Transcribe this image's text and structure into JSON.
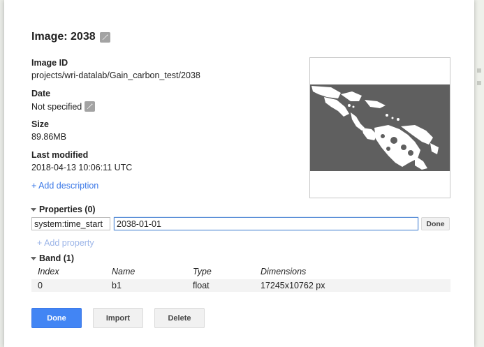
{
  "dialog": {
    "title": "Image: 2038",
    "image_id_label": "Image ID",
    "image_id_value": "projects/wri-datalab/Gain_carbon_test/2038",
    "date_label": "Date",
    "date_value": "Not specified",
    "size_label": "Size",
    "size_value": "89.86MB",
    "modified_label": "Last modified",
    "modified_value": "2018-04-13 10:06:11 UTC",
    "add_description": "+ Add description"
  },
  "properties": {
    "header": "Properties (0)",
    "key": "system:time_start",
    "value": "2038-01-01",
    "done_label": "Done",
    "add_property": "+ Add property"
  },
  "band": {
    "header": "Band (1)",
    "columns": [
      "Index",
      "Name",
      "Type",
      "Dimensions"
    ],
    "rows": [
      [
        "0",
        "b1",
        "float",
        "17245x10762 px"
      ]
    ]
  },
  "buttons": {
    "done": "Done",
    "import": "Import",
    "delete": "Delete"
  },
  "colors": {
    "accent": "#4285f4",
    "link": "#3b78e7",
    "thumbnail_bg": "#5f5f5f"
  },
  "icons": [
    "edit-pencil-icon",
    "triangle-down-icon"
  ]
}
